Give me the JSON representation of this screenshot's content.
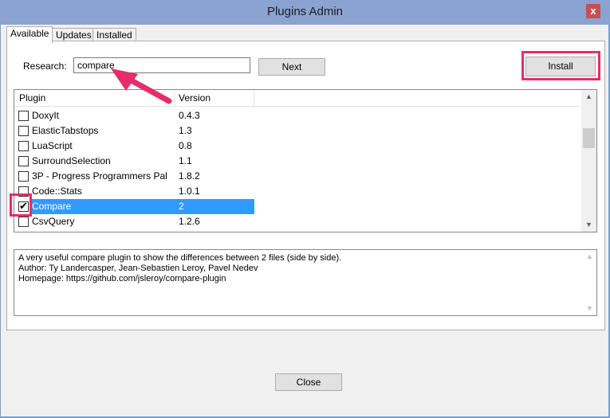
{
  "window": {
    "title": "Plugins Admin",
    "close_glyph": "x"
  },
  "tabs": [
    {
      "label": "Available",
      "active": true
    },
    {
      "label": "Updates",
      "active": false
    },
    {
      "label": "Installed",
      "active": false
    }
  ],
  "search": {
    "label": "Research:",
    "value": "compare"
  },
  "buttons": {
    "next": "Next",
    "install": "Install",
    "close": "Close"
  },
  "list": {
    "columns": [
      "Plugin",
      "Version"
    ],
    "rows": [
      {
        "name": "DoxyIt",
        "version": "0.4.3",
        "checked": false,
        "selected": false
      },
      {
        "name": "ElasticTabstops",
        "version": "1.3",
        "checked": false,
        "selected": false
      },
      {
        "name": "LuaScript",
        "version": "0.8",
        "checked": false,
        "selected": false
      },
      {
        "name": "SurroundSelection",
        "version": "1.1",
        "checked": false,
        "selected": false
      },
      {
        "name": "3P - Progress Programmers Pal",
        "version": "1.8.2",
        "checked": false,
        "selected": false
      },
      {
        "name": "Code::Stats",
        "version": "1.0.1",
        "checked": false,
        "selected": false
      },
      {
        "name": "Compare",
        "version": "2",
        "checked": true,
        "selected": true
      },
      {
        "name": "CsvQuery",
        "version": "1.2.6",
        "checked": false,
        "selected": false
      }
    ]
  },
  "description": {
    "lines": [
      "A very useful compare plugin to show the differences between 2 files (side by side).",
      "Author: Ty Landercasper, Jean-Sebastien Leroy, Pavel Nedev",
      "Homepage: https://github.com/jsleroy/compare-plugin"
    ]
  },
  "annotations": {
    "highlight_color": "#e62c6b"
  },
  "colors": {
    "selection": "#3399ff",
    "titlebar": "#8aa3d1"
  }
}
